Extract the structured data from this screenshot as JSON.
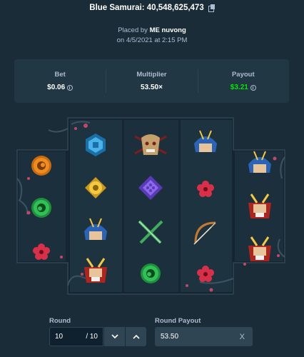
{
  "header": {
    "title": "Blue Samurai: 40,548,625,473",
    "copy_icon": "copy-icon"
  },
  "placed": {
    "prefix": "Placed by",
    "user": "ME nuvong",
    "date_line": "on 4/5/2021 at 2:15 PM"
  },
  "stats": {
    "bet_label": "Bet",
    "bet_value": "$0.06",
    "multiplier_label": "Multiplier",
    "multiplier_value": "53.50×",
    "payout_label": "Payout",
    "payout_value": "$3.21",
    "currency_icon": "coin-icon",
    "payout_color": "#00e701"
  },
  "board": {
    "reels": [
      [
        "orange-mitsudomoe-coin",
        "green-mitsudomoe-coin",
        "red-plum-crest"
      ],
      [
        "blue-hexagon-crest",
        "gold-flower-crest",
        "blue-samurai-helmet",
        "red-samurai-mask"
      ],
      [
        "oni-mask-with-swords",
        "purple-diamond-crest",
        "crossed-green-swords",
        "green-mitsudomoe-coin"
      ],
      [
        "blue-samurai-helmet",
        "red-plum-crest",
        "bow-and-arrow",
        "red-plum-crest"
      ],
      [
        "blue-samurai-helmet",
        "red-samurai-mask",
        "red-samurai-mask"
      ]
    ]
  },
  "round": {
    "label": "Round",
    "value": "10",
    "total": "/ 10",
    "down_icon": "chevron-down-icon",
    "up_icon": "chevron-up-icon"
  },
  "round_payout": {
    "label": "Round Payout",
    "value": "53.50",
    "clear": "X"
  }
}
